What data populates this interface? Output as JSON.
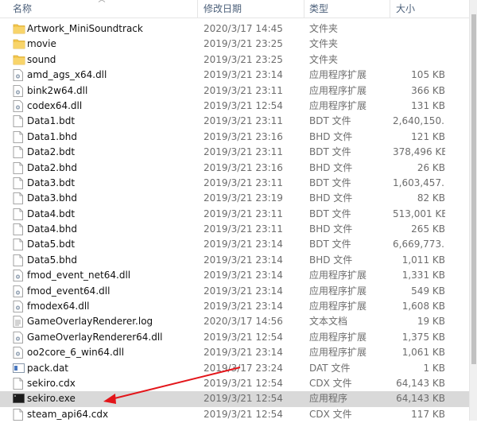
{
  "columns": {
    "name": "名称",
    "modified": "修改日期",
    "type": "类型",
    "size": "大小"
  },
  "files": [
    {
      "name": "Artwork_MiniSoundtrack",
      "modified": "2020/3/17 14:45",
      "type": "文件夹",
      "size": "",
      "icon": "folder-icon"
    },
    {
      "name": "movie",
      "modified": "2019/3/21 23:25",
      "type": "文件夹",
      "size": "",
      "icon": "folder-icon"
    },
    {
      "name": "sound",
      "modified": "2019/3/21 23:25",
      "type": "文件夹",
      "size": "",
      "icon": "folder-icon"
    },
    {
      "name": "amd_ags_x64.dll",
      "modified": "2019/3/21 23:14",
      "type": "应用程序扩展",
      "size": "105 KB",
      "icon": "dll-icon"
    },
    {
      "name": "bink2w64.dll",
      "modified": "2019/3/21 23:11",
      "type": "应用程序扩展",
      "size": "366 KB",
      "icon": "dll-icon"
    },
    {
      "name": "codex64.dll",
      "modified": "2019/3/21 12:54",
      "type": "应用程序扩展",
      "size": "131 KB",
      "icon": "dll-icon"
    },
    {
      "name": "Data1.bdt",
      "modified": "2019/3/21 23:11",
      "type": "BDT 文件",
      "size": "2,640,150...",
      "icon": "file-icon"
    },
    {
      "name": "Data1.bhd",
      "modified": "2019/3/21 23:16",
      "type": "BHD 文件",
      "size": "121 KB",
      "icon": "file-icon"
    },
    {
      "name": "Data2.bdt",
      "modified": "2019/3/21 23:11",
      "type": "BDT 文件",
      "size": "378,496 KB",
      "icon": "file-icon"
    },
    {
      "name": "Data2.bhd",
      "modified": "2019/3/21 23:16",
      "type": "BHD 文件",
      "size": "26 KB",
      "icon": "file-icon"
    },
    {
      "name": "Data3.bdt",
      "modified": "2019/3/21 23:11",
      "type": "BDT 文件",
      "size": "1,603,457...",
      "icon": "file-icon"
    },
    {
      "name": "Data3.bhd",
      "modified": "2019/3/21 23:19",
      "type": "BHD 文件",
      "size": "82 KB",
      "icon": "file-icon"
    },
    {
      "name": "Data4.bdt",
      "modified": "2019/3/21 23:11",
      "type": "BDT 文件",
      "size": "513,001 KB",
      "icon": "file-icon"
    },
    {
      "name": "Data4.bhd",
      "modified": "2019/3/21 23:11",
      "type": "BHD 文件",
      "size": "265 KB",
      "icon": "file-icon"
    },
    {
      "name": "Data5.bdt",
      "modified": "2019/3/21 23:14",
      "type": "BDT 文件",
      "size": "6,669,773...",
      "icon": "file-icon"
    },
    {
      "name": "Data5.bhd",
      "modified": "2019/3/21 23:14",
      "type": "BHD 文件",
      "size": "1,011 KB",
      "icon": "file-icon"
    },
    {
      "name": "fmod_event_net64.dll",
      "modified": "2019/3/21 23:14",
      "type": "应用程序扩展",
      "size": "1,331 KB",
      "icon": "dll-icon"
    },
    {
      "name": "fmod_event64.dll",
      "modified": "2019/3/21 23:14",
      "type": "应用程序扩展",
      "size": "549 KB",
      "icon": "dll-icon"
    },
    {
      "name": "fmodex64.dll",
      "modified": "2019/3/21 23:14",
      "type": "应用程序扩展",
      "size": "1,608 KB",
      "icon": "dll-icon"
    },
    {
      "name": "GameOverlayRenderer.log",
      "modified": "2020/3/17 14:56",
      "type": "文本文档",
      "size": "19 KB",
      "icon": "text-file-icon"
    },
    {
      "name": "GameOverlayRenderer64.dll",
      "modified": "2019/3/21 12:54",
      "type": "应用程序扩展",
      "size": "1,375 KB",
      "icon": "dll-icon"
    },
    {
      "name": "oo2core_6_win64.dll",
      "modified": "2019/3/21 23:14",
      "type": "应用程序扩展",
      "size": "1,061 KB",
      "icon": "dll-icon"
    },
    {
      "name": "pack.dat",
      "modified": "2019/3/17 23:24",
      "type": "DAT 文件",
      "size": "1 KB",
      "icon": "dat-file-icon"
    },
    {
      "name": "sekiro.cdx",
      "modified": "2019/3/21 12:54",
      "type": "CDX 文件",
      "size": "64,143 KB",
      "icon": "file-icon"
    },
    {
      "name": "sekiro.exe",
      "modified": "2019/3/21 12:54",
      "type": "应用程序",
      "size": "64,143 KB",
      "icon": "exe-icon",
      "selected": true
    },
    {
      "name": "steam_api64.cdx",
      "modified": "2019/3/21 12:54",
      "type": "CDX 文件",
      "size": "117 KB",
      "icon": "file-icon"
    }
  ],
  "colors": {
    "header_text": "#4c607a",
    "selected_row": "#d9d9d9",
    "folder": "#f3c74f",
    "annotation_arrow": "#e3151a"
  }
}
